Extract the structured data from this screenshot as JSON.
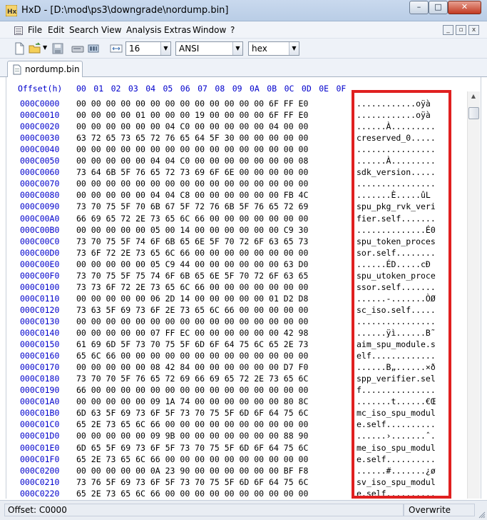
{
  "window": {
    "title": "HxD - [D:\\mod\\ps3\\downgrade\\nordump.bin]",
    "controls": {
      "minimize": "–",
      "maximize": "□",
      "close": "✕"
    }
  },
  "menu": {
    "items": [
      "File",
      "Edit",
      "Search",
      "View",
      "Analysis",
      "Extras",
      "Window",
      "?"
    ],
    "mdi_controls": [
      "_",
      "▫",
      "x"
    ]
  },
  "toolbar": {
    "bytes_per_row": "16",
    "charset": "ANSI",
    "display_mode": "hex"
  },
  "tab": {
    "label": "nordump.bin"
  },
  "hex_view": {
    "header_offset": "Offset(h)",
    "header_columns": [
      "00",
      "01",
      "02",
      "03",
      "04",
      "05",
      "06",
      "07",
      "08",
      "09",
      "0A",
      "0B",
      "0C",
      "0D",
      "0E",
      "0F"
    ],
    "rows": [
      {
        "offset": "000C0000",
        "hex": "00 00 00 00 00 00 00 00 00 00 00 00 00 6F FF E0",
        "text": "............oÿà"
      },
      {
        "offset": "000C0010",
        "hex": "00 00 00 00 01 00 00 00 19 00 00 00 00 6F FF E0",
        "text": "............oÿà"
      },
      {
        "offset": "000C0020",
        "hex": "00 00 00 00 00 00 04 C0 00 00 00 00 00 04 00 00",
        "text": "......À........."
      },
      {
        "offset": "000C0030",
        "hex": "63 72 65 73 65 72 76 65 64 5F 30 00 00 00 00 00",
        "text": "creserved_0....."
      },
      {
        "offset": "000C0040",
        "hex": "00 00 00 00 00 00 00 00 00 00 00 00 00 00 00 00",
        "text": "................"
      },
      {
        "offset": "000C0050",
        "hex": "00 00 00 00 00 04 04 C0 00 00 00 00 00 00 00 08",
        "text": "......À........."
      },
      {
        "offset": "000C0060",
        "hex": "73 64 6B 5F 76 65 72 73 69 6F 6E 00 00 00 00 00",
        "text": "sdk_version....."
      },
      {
        "offset": "000C0070",
        "hex": "00 00 00 00 00 00 00 00 00 00 00 00 00 00 00 00",
        "text": "................"
      },
      {
        "offset": "000C0080",
        "hex": "00 00 00 00 00 04 04 C8 00 00 00 00 00 00 FB 4C",
        "text": ".......È.....ûL"
      },
      {
        "offset": "000C0090",
        "hex": "73 70 75 5F 70 6B 67 5F 72 76 6B 5F 76 65 72 69",
        "text": "spu_pkg_rvk_veri"
      },
      {
        "offset": "000C00A0",
        "hex": "66 69 65 72 2E 73 65 6C 66 00 00 00 00 00 00 00",
        "text": "fier.self......."
      },
      {
        "offset": "000C00B0",
        "hex": "00 00 00 00 00 05 00 14 00 00 00 00 00 00 C9 30",
        "text": "..............É0"
      },
      {
        "offset": "000C00C0",
        "hex": "73 70 75 5F 74 6F 6B 65 6E 5F 70 72 6F 63 65 73",
        "text": "spu_token_proces"
      },
      {
        "offset": "000C00D0",
        "hex": "73 6F 72 2E 73 65 6C 66 00 00 00 00 00 00 00 00",
        "text": "sor.self........"
      },
      {
        "offset": "000C00E0",
        "hex": "00 00 00 00 00 05 C9 44 00 00 00 00 00 00 63 D0",
        "text": "......ÉD.....cÐ"
      },
      {
        "offset": "000C00F0",
        "hex": "73 70 75 5F 75 74 6F 6B 65 6E 5F 70 72 6F 63 65",
        "text": "spu_utoken_proce"
      },
      {
        "offset": "000C0100",
        "hex": "73 73 6F 72 2E 73 65 6C 66 00 00 00 00 00 00 00",
        "text": "ssor.self......."
      },
      {
        "offset": "000C0110",
        "hex": "00 00 00 00 00 06 2D 14 00 00 00 00 00 01 D2 D8",
        "text": "......-.......ÒØ"
      },
      {
        "offset": "000C0120",
        "hex": "73 63 5F 69 73 6F 2E 73 65 6C 66 00 00 00 00 00",
        "text": "sc_iso.self....."
      },
      {
        "offset": "000C0130",
        "hex": "00 00 00 00 00 00 00 00 00 00 00 00 00 00 00 00",
        "text": "................"
      },
      {
        "offset": "000C0140",
        "hex": "00 00 00 00 00 07 FF EC 00 00 00 00 00 00 42 98",
        "text": "......ÿì......B˜"
      },
      {
        "offset": "000C0150",
        "hex": "61 69 6D 5F 73 70 75 5F 6D 6F 64 75 6C 65 2E 73",
        "text": "aim_spu_module.s"
      },
      {
        "offset": "000C0160",
        "hex": "65 6C 66 00 00 00 00 00 00 00 00 00 00 00 00 00",
        "text": "elf............."
      },
      {
        "offset": "000C0170",
        "hex": "00 00 00 00 00 08 42 84 00 00 00 00 00 00 D7 F0",
        "text": "......B„......×ð"
      },
      {
        "offset": "000C0180",
        "hex": "73 70 70 5F 76 65 72 69 66 69 65 72 2E 73 65 6C",
        "text": "spp_verifier.sel"
      },
      {
        "offset": "000C0190",
        "hex": "66 00 00 00 00 00 00 00 00 00 00 00 00 00 00 00",
        "text": "f..............."
      },
      {
        "offset": "000C01A0",
        "hex": "00 00 00 00 00 09 1A 74 00 00 00 00 00 00 80 8C",
        "text": ".......t......€Œ"
      },
      {
        "offset": "000C01B0",
        "hex": "6D 63 5F 69 73 6F 5F 73 70 75 5F 6D 6F 64 75 6C",
        "text": "mc_iso_spu_modul"
      },
      {
        "offset": "000C01C0",
        "hex": "65 2E 73 65 6C 66 00 00 00 00 00 00 00 00 00 00",
        "text": "e.self.........."
      },
      {
        "offset": "000C01D0",
        "hex": "00 00 00 00 00 09 9B 00 00 00 00 00 00 00 88 90",
        "text": "......›.......ˆ."
      },
      {
        "offset": "000C01E0",
        "hex": "6D 65 5F 69 73 6F 5F 73 70 75 5F 6D 6F 64 75 6C",
        "text": "me_iso_spu_modul"
      },
      {
        "offset": "000C01F0",
        "hex": "65 2E 73 65 6C 66 00 00 00 00 00 00 00 00 00 00",
        "text": "e.self.........."
      },
      {
        "offset": "000C0200",
        "hex": "00 00 00 00 00 0A 23 90 00 00 00 00 00 00 BF F8",
        "text": "......#.......¿ø"
      },
      {
        "offset": "000C0210",
        "hex": "73 76 5F 69 73 6F 5F 73 70 75 5F 6D 6F 64 75 6C",
        "text": "sv_iso_spu_modul"
      },
      {
        "offset": "000C0220",
        "hex": "65 2E 73 65 6C 66 00 00 00 00 00 00 00 00 00 00",
        "text": "e.self.........."
      }
    ]
  },
  "status": {
    "offset": "Offset: C0000",
    "mode": "Overwrite"
  },
  "colors": {
    "offset_blue": "#0000cc",
    "highlight_red": "#e02020"
  }
}
